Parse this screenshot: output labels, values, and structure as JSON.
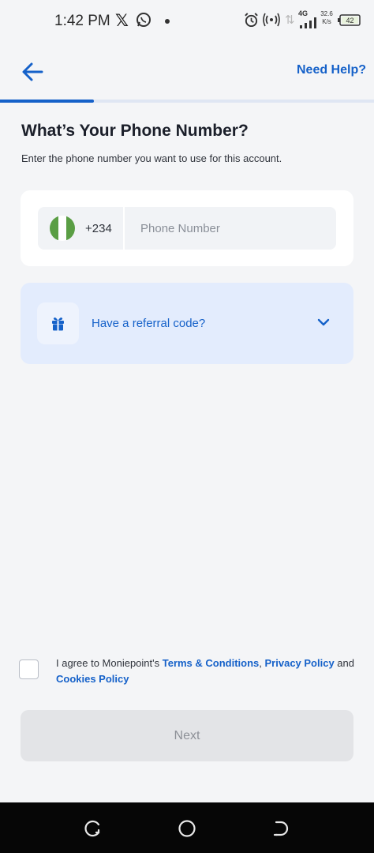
{
  "status_bar": {
    "time": "1:42 PM",
    "network": "4G",
    "speed_value": "32.6",
    "speed_unit": "K/s",
    "battery": "42",
    "icons": [
      "x-logo-icon",
      "whatsapp-icon",
      "notification-dot-icon",
      "alarm-icon",
      "hotspot-icon",
      "data-arrows-icon",
      "signal-icon",
      "battery-icon"
    ]
  },
  "header": {
    "back_icon": "arrow-left-icon",
    "help_label": "Need Help?"
  },
  "progress": {
    "value": 0.25
  },
  "page": {
    "title": "What’s Your Phone Number?",
    "subtitle": "Enter the phone number you want to use for this account."
  },
  "phone": {
    "country_flag": "nigeria-flag-icon",
    "dial_code": "+234",
    "value": "",
    "placeholder": "Phone Number"
  },
  "referral": {
    "icon": "gift-icon",
    "label": "Have a referral code?",
    "chevron": "chevron-down-icon"
  },
  "agreement": {
    "checked": false,
    "prefix": "I agree to Moniepoint's ",
    "terms_link": "Terms & Conditions",
    "separator": ", ",
    "privacy_link": "Privacy Policy",
    "conjunction": " and ",
    "cookies_link": "Cookies Policy"
  },
  "next_button": {
    "label": "Next",
    "enabled": false
  },
  "nav": {
    "icons": [
      "recent-apps-icon",
      "home-icon",
      "back-icon"
    ]
  },
  "colors": {
    "primary": "#1561c9",
    "background": "#f4f5f7",
    "referral_bg": "#e3ecfd",
    "disabled_button": "#e3e4e7",
    "flag_green": "#5a9e44"
  }
}
